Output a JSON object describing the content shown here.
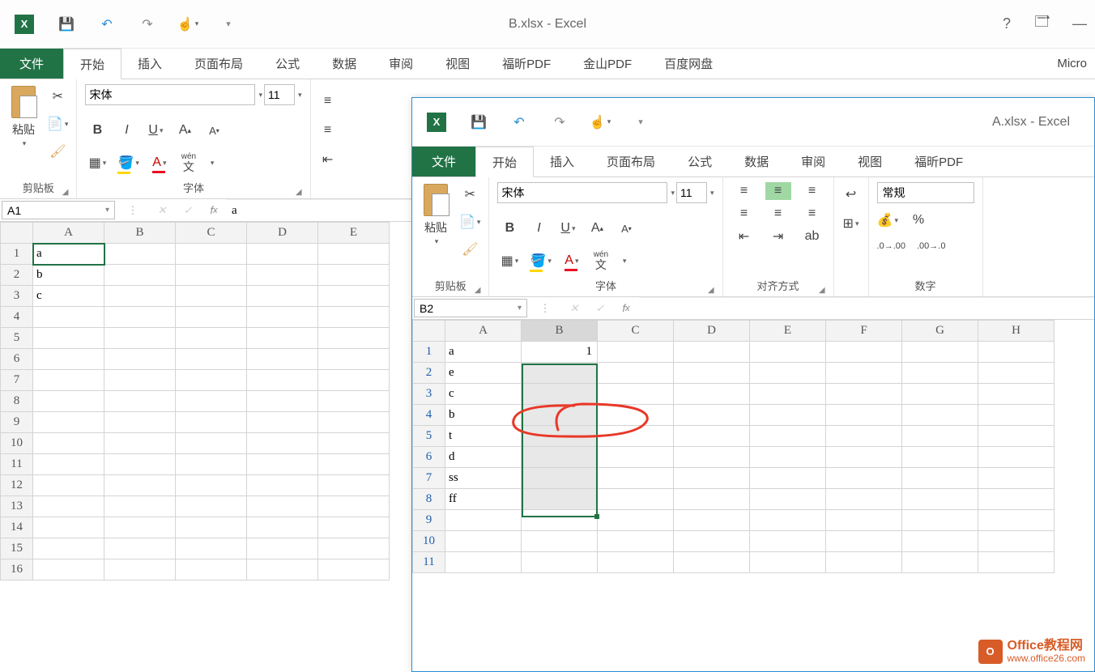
{
  "win1": {
    "title": "B.xlsx - Excel",
    "qat_save": "💾",
    "tabs": {
      "file": "文件",
      "home": "开始",
      "insert": "插入",
      "page": "页面布局",
      "formula": "公式",
      "data": "数据",
      "review": "审阅",
      "view": "视图",
      "foxit": "福昕PDF",
      "wps": "金山PDF",
      "baidu": "百度网盘",
      "micro": "Micro"
    },
    "ribbon": {
      "paste": "粘贴",
      "clipboard": "剪贴板",
      "font_group": "字体",
      "font_name": "宋体",
      "font_size": "11"
    },
    "namebox": "A1",
    "formula": "a",
    "columns": [
      "A",
      "B",
      "C",
      "D",
      "E"
    ],
    "rows": [
      {
        "n": "1",
        "cells": [
          "a",
          "",
          "",
          "",
          ""
        ]
      },
      {
        "n": "2",
        "cells": [
          "b",
          "",
          "",
          "",
          ""
        ]
      },
      {
        "n": "3",
        "cells": [
          "c",
          "",
          "",
          "",
          ""
        ]
      },
      {
        "n": "4",
        "cells": [
          "",
          "",
          "",
          "",
          ""
        ]
      },
      {
        "n": "5",
        "cells": [
          "",
          "",
          "",
          "",
          ""
        ]
      },
      {
        "n": "6",
        "cells": [
          "",
          "",
          "",
          "",
          ""
        ]
      },
      {
        "n": "7",
        "cells": [
          "",
          "",
          "",
          "",
          ""
        ]
      },
      {
        "n": "8",
        "cells": [
          "",
          "",
          "",
          "",
          ""
        ]
      },
      {
        "n": "9",
        "cells": [
          "",
          "",
          "",
          "",
          ""
        ]
      },
      {
        "n": "10",
        "cells": [
          "",
          "",
          "",
          "",
          ""
        ]
      },
      {
        "n": "11",
        "cells": [
          "",
          "",
          "",
          "",
          ""
        ]
      },
      {
        "n": "12",
        "cells": [
          "",
          "",
          "",
          "",
          ""
        ]
      },
      {
        "n": "13",
        "cells": [
          "",
          "",
          "",
          "",
          ""
        ]
      },
      {
        "n": "14",
        "cells": [
          "",
          "",
          "",
          "",
          ""
        ]
      },
      {
        "n": "15",
        "cells": [
          "",
          "",
          "",
          "",
          ""
        ]
      },
      {
        "n": "16",
        "cells": [
          "",
          "",
          "",
          "",
          ""
        ]
      }
    ]
  },
  "win2": {
    "title": "A.xlsx - Excel",
    "tabs": {
      "file": "文件",
      "home": "开始",
      "insert": "插入",
      "page": "页面布局",
      "formula": "公式",
      "data": "数据",
      "review": "审阅",
      "view": "视图",
      "foxit": "福昕PDF"
    },
    "ribbon": {
      "paste": "粘贴",
      "clipboard": "剪贴板",
      "font_group": "字体",
      "align_group": "对齐方式",
      "number_group": "数字",
      "font_name": "宋体",
      "font_size": "11",
      "num_fmt": "常规",
      "wen": "wén",
      "wen2": "文"
    },
    "namebox": "B2",
    "formula": "",
    "columns": [
      "A",
      "B",
      "C",
      "D",
      "E",
      "F",
      "G",
      "H"
    ],
    "rows": [
      {
        "n": "1",
        "cells": [
          "a",
          "1",
          "",
          "",
          "",
          "",
          "",
          ""
        ]
      },
      {
        "n": "2",
        "cells": [
          "e",
          "",
          "",
          "",
          "",
          "",
          "",
          ""
        ]
      },
      {
        "n": "3",
        "cells": [
          "c",
          "",
          "",
          "",
          "",
          "",
          "",
          ""
        ]
      },
      {
        "n": "4",
        "cells": [
          "b",
          "",
          "",
          "",
          "",
          "",
          "",
          ""
        ]
      },
      {
        "n": "5",
        "cells": [
          "t",
          "",
          "",
          "",
          "",
          "",
          "",
          ""
        ]
      },
      {
        "n": "6",
        "cells": [
          "d",
          "",
          "",
          "",
          "",
          "",
          "",
          ""
        ]
      },
      {
        "n": "7",
        "cells": [
          "ss",
          "",
          "",
          "",
          "",
          "",
          "",
          ""
        ]
      },
      {
        "n": "8",
        "cells": [
          "ff",
          "",
          "",
          "",
          "",
          "",
          "",
          ""
        ]
      },
      {
        "n": "9",
        "cells": [
          "",
          "",
          "",
          "",
          "",
          "",
          "",
          ""
        ]
      },
      {
        "n": "10",
        "cells": [
          "",
          "",
          "",
          "",
          "",
          "",
          "",
          ""
        ]
      },
      {
        "n": "11",
        "cells": [
          "",
          "",
          "",
          "",
          "",
          "",
          "",
          ""
        ]
      }
    ]
  },
  "watermark": {
    "line1": "Office教程网",
    "line2": "www.office26.com"
  }
}
